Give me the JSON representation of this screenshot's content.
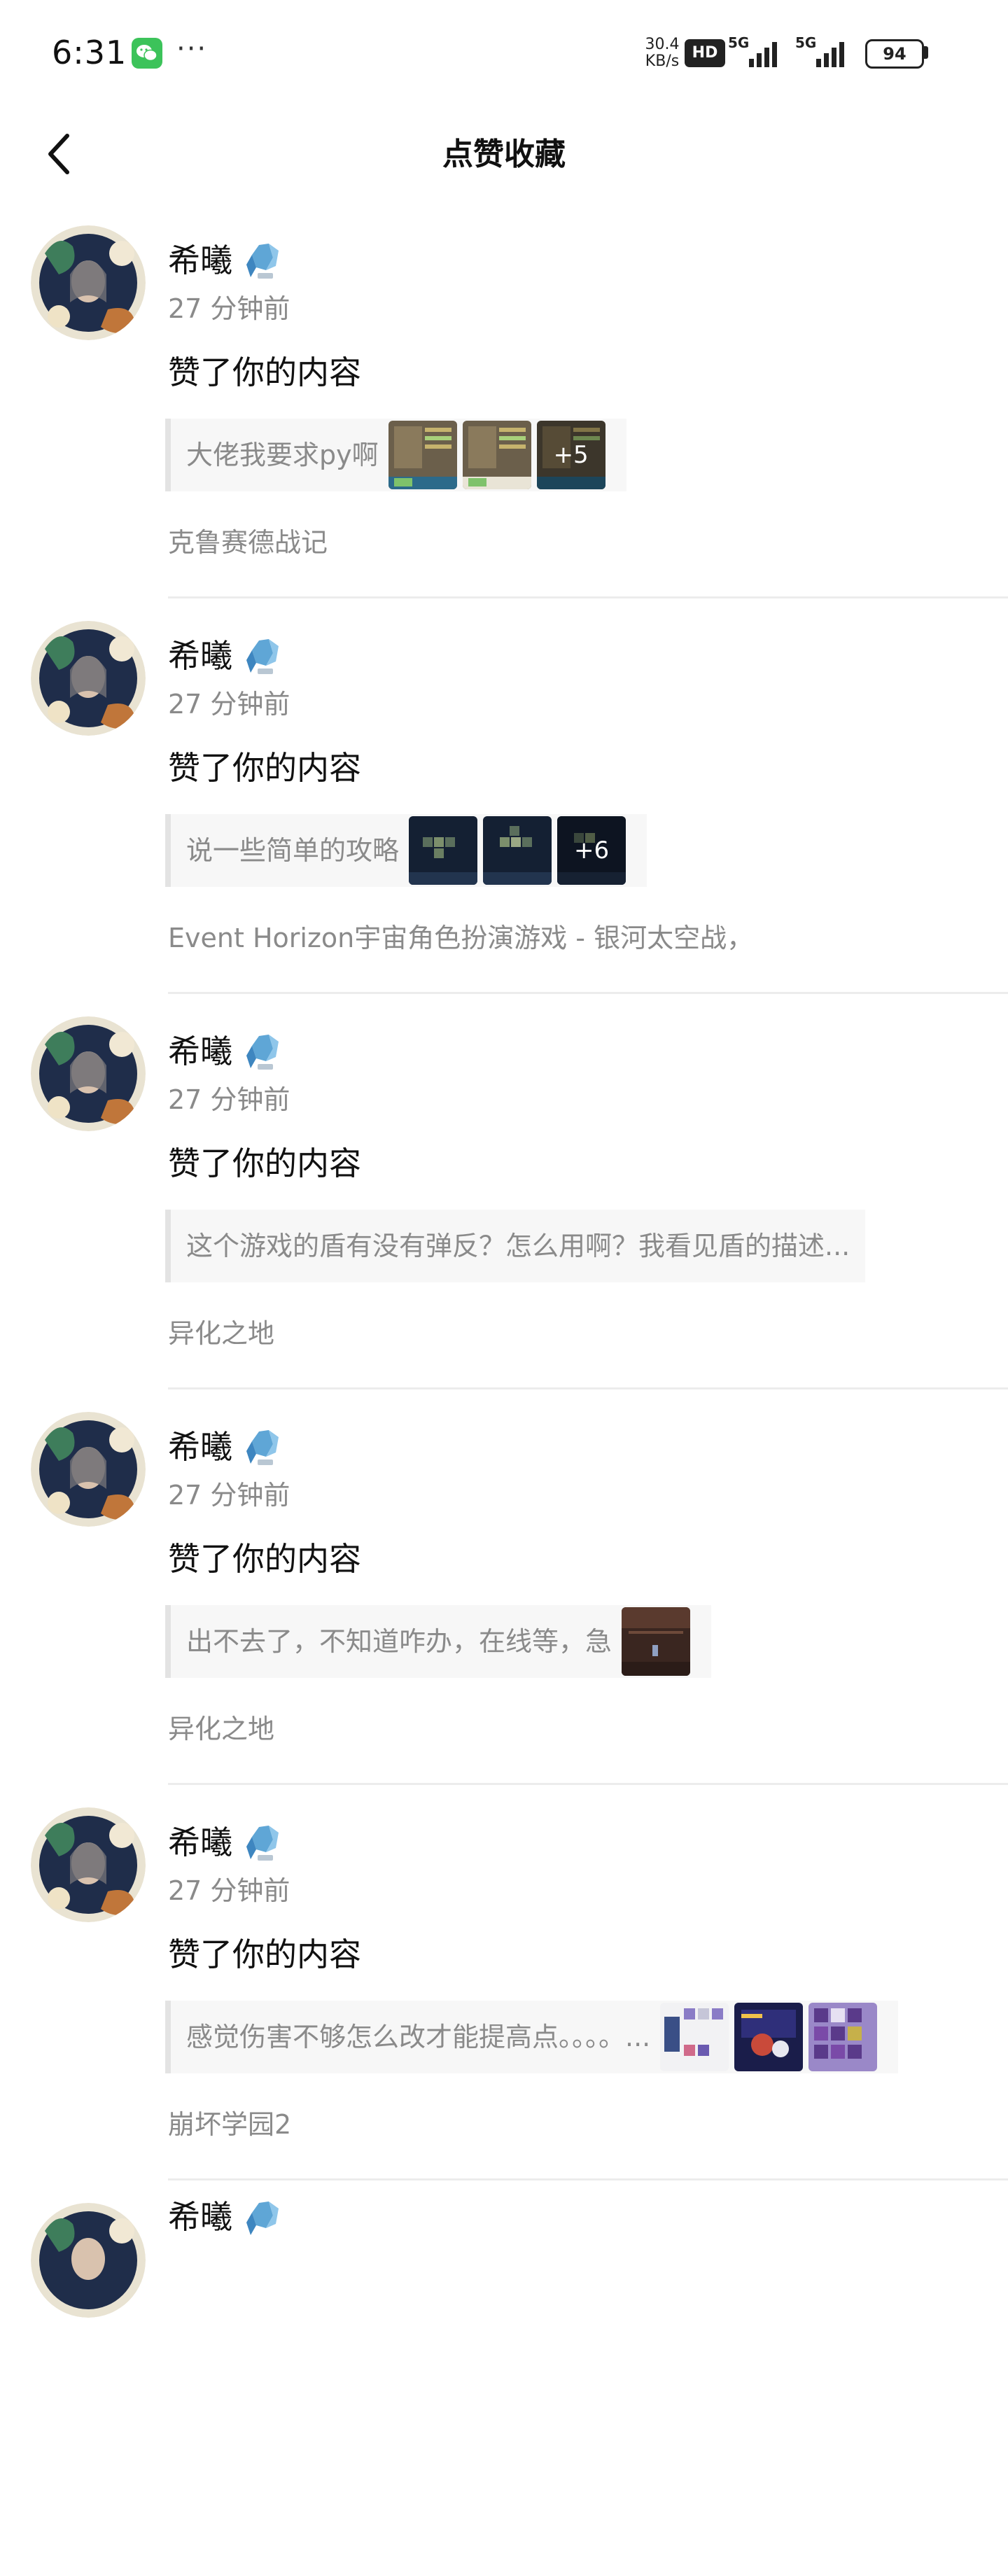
{
  "status_bar": {
    "time": "6:31",
    "dots": "···",
    "net_speed_value": "30.4",
    "net_speed_unit": "KB/s",
    "hd_label": "HD",
    "signal_1_gen": "5G",
    "signal_2_gen": "5G",
    "battery": "94",
    "icons": [
      "wechat-icon",
      "signal-icon",
      "battery-icon"
    ]
  },
  "header": {
    "title": "点赞收藏",
    "back_icon": "chevron-left-icon"
  },
  "colors": {
    "text_primary": "#111111",
    "text_secondary": "#8a8a8a",
    "quote_background": "#f7f7f7",
    "quote_bar": "#e3e3e3",
    "divider": "#ececec",
    "wechat_green": "#3cc35a"
  },
  "notifications": [
    {
      "user": "希曦",
      "time": "27 分钟前",
      "action": "赞了你的内容",
      "quote": "大佬我要求py啊",
      "thumb_count": 3,
      "more_label": "+5",
      "game": "克鲁赛德战记"
    },
    {
      "user": "希曦",
      "time": "27 分钟前",
      "action": "赞了你的内容",
      "quote": "说一些简单的攻略",
      "thumb_count": 3,
      "more_label": "+6",
      "game": "Event Horizon宇宙角色扮演游戏 - 银河太空战，"
    },
    {
      "user": "希曦",
      "time": "27 分钟前",
      "action": "赞了你的内容",
      "quote": "这个游戏的盾有没有弹反？怎么用啊？我看见盾的描述...",
      "thumb_count": 0,
      "more_label": "",
      "game": "异化之地"
    },
    {
      "user": "希曦",
      "time": "27 分钟前",
      "action": "赞了你的内容",
      "quote": "出不去了，不知道咋办，在线等，急",
      "thumb_count": 1,
      "more_label": "",
      "game": "异化之地"
    },
    {
      "user": "希曦",
      "time": "27 分钟前",
      "action": "赞了你的内容",
      "quote": "感觉伤害不够怎么改才能提高点。。。。...",
      "thumb_count": 3,
      "more_label": "",
      "game": "崩坏学园2"
    }
  ],
  "partial_item": {
    "user": "希曦"
  }
}
